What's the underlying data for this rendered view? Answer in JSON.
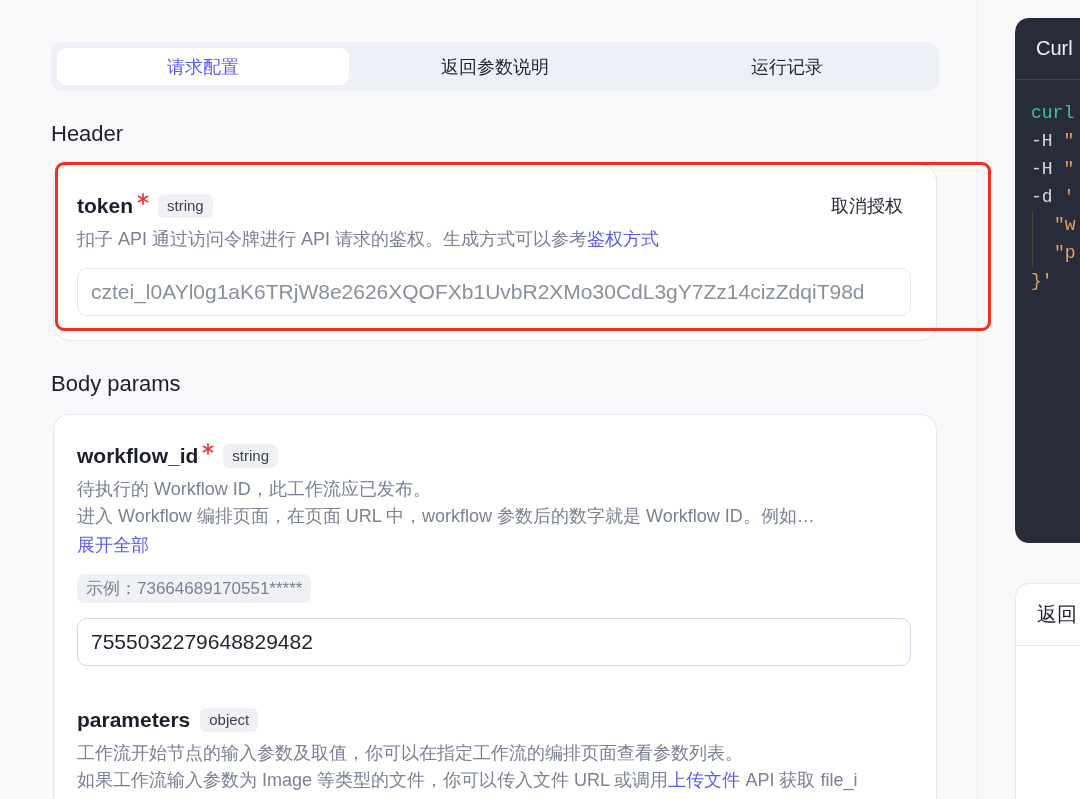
{
  "tabs": [
    {
      "label": "请求配置",
      "selected": true
    },
    {
      "label": "返回参数说明",
      "selected": false
    },
    {
      "label": "运行记录",
      "selected": false
    }
  ],
  "sections": [
    {
      "title": "Header",
      "params": [
        {
          "name": "token",
          "required": true,
          "type": "string",
          "action": "取消授权",
          "highlighted": true,
          "description": [
            {
              "segments": [
                {
                  "kind": "plain",
                  "text": "扣子 API 通过访问令牌进行 API 请求的鉴权。生成方式可以参考"
                },
                {
                  "kind": "link",
                  "text": "鉴权方式"
                }
              ]
            }
          ],
          "input": {
            "value": "cztei_l0AYl0g1aK6TRjW8e2626XQOFXb1UvbR2XMo30CdL3gY7Zz14cizZdqiT98d",
            "disabled": true
          }
        }
      ]
    },
    {
      "title": "Body params",
      "params": [
        {
          "name": "workflow_id",
          "required": true,
          "type": "string",
          "highlighted": false,
          "description": [
            {
              "segments": [
                {
                  "kind": "plain",
                  "text": "待执行的 Workflow ID，此工作流应已发布。"
                }
              ]
            },
            {
              "segments": [
                {
                  "kind": "plain",
                  "text": "进入 Workflow 编排页面，在页面 URL 中，workflow 参数后的数字就是 Workflow ID。例如…"
                }
              ]
            }
          ],
          "expand_link": "展开全部",
          "example": "示例：73664689170551*****",
          "input": {
            "value": "7555032279648829482",
            "disabled": false
          }
        },
        {
          "name": "parameters",
          "required": false,
          "type": "object",
          "highlighted": false,
          "description": [
            {
              "segments": [
                {
                  "kind": "plain",
                  "text": "工作流开始节点的输入参数及取值，你可以在指定工作流的编排页面查看参数列表。"
                }
              ]
            },
            {
              "segments": [
                {
                  "kind": "plain",
                  "text": "如果工作流输入参数为 Image 等类型的文件，你可以传入文件 URL 或调用"
                },
                {
                  "kind": "link",
                  "text": "上传文件"
                },
                {
                  "kind": "plain",
                  "text": " API 获取 file_i"
                }
              ]
            }
          ]
        }
      ]
    }
  ],
  "code_panel": {
    "title": "Curl",
    "lines": [
      {
        "segments": [
          {
            "kind": "command",
            "text": "curl"
          }
        ]
      },
      {
        "segments": [
          {
            "kind": "flag",
            "text": "-H "
          },
          {
            "kind": "string",
            "text": "\""
          }
        ]
      },
      {
        "segments": [
          {
            "kind": "flag",
            "text": "-H "
          },
          {
            "kind": "string",
            "text": "\""
          }
        ]
      },
      {
        "segments": [
          {
            "kind": "flag",
            "text": "-d "
          },
          {
            "kind": "string",
            "text": "'"
          }
        ],
        "children": [
          {
            "segments": [
              {
                "kind": "string",
                "text": "\"w"
              }
            ]
          },
          {
            "segments": [
              {
                "kind": "string",
                "text": "\"p"
              }
            ]
          }
        ]
      },
      {
        "segments": [
          {
            "kind": "string",
            "text": "}'"
          }
        ]
      }
    ]
  },
  "response_panel": {
    "title": "返回"
  }
}
